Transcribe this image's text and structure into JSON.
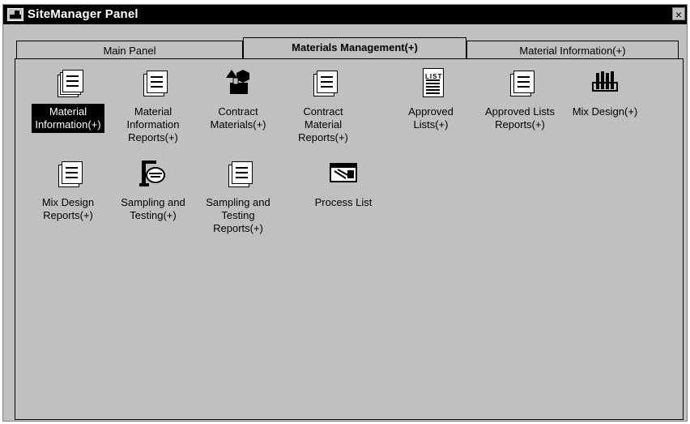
{
  "window": {
    "title": "SiteManager Panel",
    "close_glyph": "×"
  },
  "tabs": [
    {
      "label": "Main Panel",
      "active": false
    },
    {
      "label": "Materials Management(+)",
      "active": true
    },
    {
      "label": "Material Information(+)",
      "active": false
    }
  ],
  "items": [
    {
      "label": "Material\nInformation(+)",
      "icon": "stacked-documents-icon",
      "selected": true
    },
    {
      "label": "Material\nInformation\nReports(+)",
      "icon": "reports-icon",
      "selected": false
    },
    {
      "label": "Contract\nMaterials(+)",
      "icon": "materials-icon",
      "selected": false
    },
    {
      "label": "Contract Material\nReports(+)",
      "icon": "reports-icon",
      "selected": false
    },
    {
      "label": "Approved\nLists(+)",
      "icon": "list-icon",
      "selected": false
    },
    {
      "label": "Approved Lists\nReports(+)",
      "icon": "reports-icon",
      "selected": false
    },
    {
      "label": "Mix Design(+)",
      "icon": "test-tubes-icon",
      "selected": false
    },
    {
      "label": "Mix Design\nReports(+)",
      "icon": "reports-icon",
      "selected": false
    },
    {
      "label": "Sampling and\nTesting(+)",
      "icon": "sampling-icon",
      "selected": false
    },
    {
      "label": "Sampling and\nTesting\nReports(+)",
      "icon": "reports-icon",
      "selected": false
    },
    {
      "label": "Process List",
      "icon": "process-list-icon",
      "selected": false
    }
  ]
}
